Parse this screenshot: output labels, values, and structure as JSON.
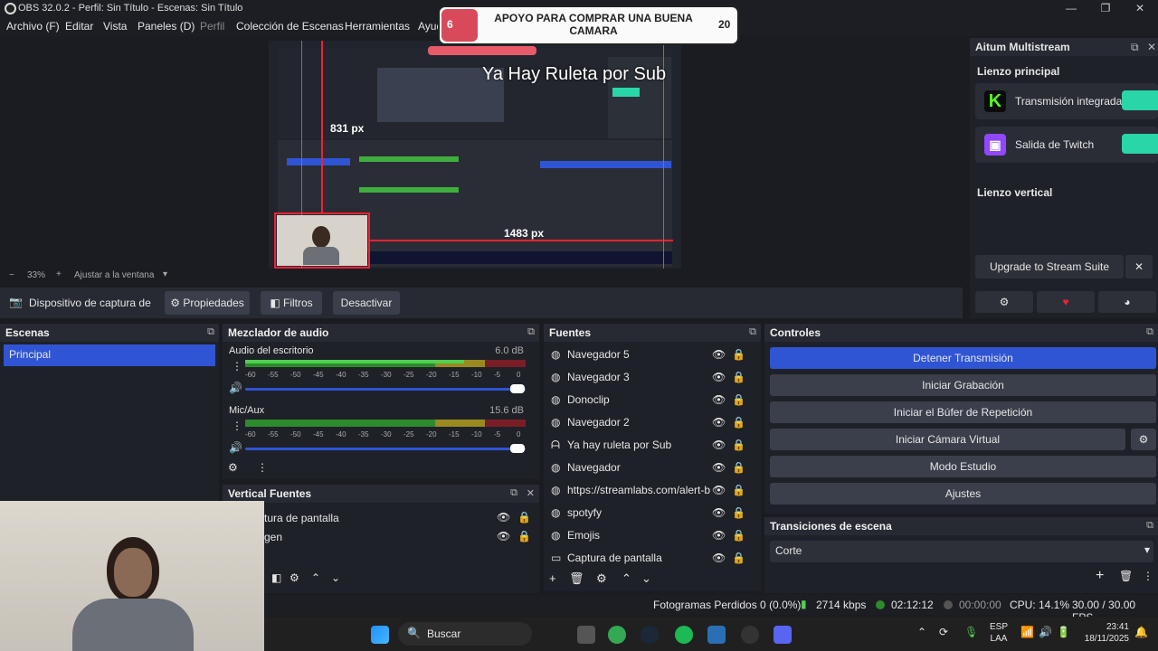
{
  "window": {
    "title": "OBS 32.0.2 - Perfil: Sin Título - Escenas: Sin Título",
    "controls": [
      "—",
      "❐",
      "✕"
    ]
  },
  "menu": [
    "Archivo (F)",
    "Editar",
    "Vista",
    "Paneles (D)",
    "Perfil",
    "Colección de Escenas",
    "Herramientas",
    "Ayuda"
  ],
  "overlay": {
    "start": "6",
    "text_line1": "APOYO PARA COMPRAR UNA BUENA",
    "text_line2": "CAMARA",
    "goal": "20",
    "subtitle": "Ya Hay Ruleta por Sub"
  },
  "preview": {
    "dim_h": "831 px",
    "dim_w": "1483 px",
    "zoom": "33%",
    "fit_label": "Ajustar a la ventana"
  },
  "sourcebar": {
    "device": "Dispositivo de captura de v",
    "properties": "Propiedades",
    "filters": "Filtros",
    "deactivate": "Desactivar"
  },
  "scenes": {
    "title": "Escenas",
    "items": [
      "Principal"
    ]
  },
  "mixer": {
    "title": "Mezclador de audio",
    "channels": [
      {
        "name": "Audio del escritorio",
        "db": "6.0 dB",
        "level": 0.78
      },
      {
        "name": "Mic/Aux",
        "db": "15.6 dB",
        "level": 0.45
      }
    ],
    "ticks": [
      "-60",
      "-55",
      "-50",
      "-45",
      "-40",
      "-35",
      "-30",
      "-25",
      "-20",
      "-15",
      "-10",
      "-5",
      "0"
    ]
  },
  "vertical_sources": {
    "title": "Vertical Fuentes",
    "items": [
      "tura de pantalla",
      "gen"
    ]
  },
  "sources": {
    "title": "Fuentes",
    "items": [
      {
        "name": "Navegador 5",
        "icon": "globe-icon"
      },
      {
        "name": "Navegador 3",
        "icon": "globe-icon"
      },
      {
        "name": "Donoclip",
        "icon": "globe-icon"
      },
      {
        "name": "Navegador 2",
        "icon": "globe-icon"
      },
      {
        "name": "Ya hay ruleta por Sub",
        "icon": "text-icon"
      },
      {
        "name": "Navegador",
        "icon": "globe-icon"
      },
      {
        "name": "https://streamlabs.com/alert-b",
        "icon": "globe-icon"
      },
      {
        "name": "spotyfy",
        "icon": "globe-icon"
      },
      {
        "name": "Emojis",
        "icon": "globe-icon"
      },
      {
        "name": "Captura de pantalla",
        "icon": "monitor-icon"
      }
    ]
  },
  "controls": {
    "title": "Controles",
    "buttons": [
      "Detener Transmisión",
      "Iniciar Grabación",
      "Iniciar el Búfer de Repetición",
      "Iniciar Cámara Virtual",
      "Modo Estudio",
      "Ajustes"
    ]
  },
  "transitions": {
    "title": "Transiciones de escena",
    "selected": "Corte"
  },
  "multistream": {
    "title": "Aitum Multistream",
    "main_canvas": "Lienzo principal",
    "outputs": [
      {
        "name": "Transmisión integrada",
        "color": "#53fc18"
      },
      {
        "name": "Salida de Twitch",
        "color": "#9146ff"
      }
    ],
    "vertical_canvas": "Lienzo vertical",
    "upgrade": "Upgrade to Stream Suite"
  },
  "status": {
    "dropped": "Fotogramas Perdidos 0 (0.0%)",
    "bitrate": "2714 kbps",
    "stream_time": "02:12:12",
    "rec_time": "00:00:00",
    "cpu": "CPU: 14.1%",
    "fps": "30.00 / 30.00 FPS"
  },
  "taskbar": {
    "search": "Buscar",
    "lang1": "ESP",
    "lang2": "LAA",
    "time": "23:41",
    "date": "18/11/2025"
  }
}
